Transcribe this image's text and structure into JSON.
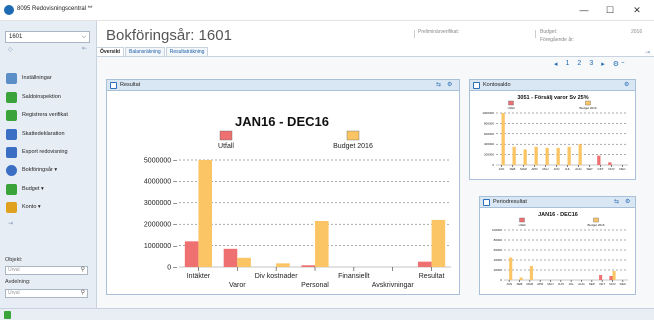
{
  "window": {
    "title": "8095 Redovisningscentral **",
    "minimize": "—",
    "maximize": "☐",
    "close": "✕"
  },
  "sidebar": {
    "year": "1601",
    "items": [
      {
        "label": "Inställningar",
        "icon": "gear-icon",
        "color": "#5c8fc7"
      },
      {
        "label": "Saldoinspektion",
        "icon": "trend-icon",
        "color": "#3aa33a"
      },
      {
        "label": "Registrera verifikat",
        "icon": "trend-icon",
        "color": "#3aa33a"
      },
      {
        "label": "Skattedeklaration",
        "icon": "percent-icon",
        "color": "#3b6fc4"
      },
      {
        "label": "Export redovisning",
        "icon": "printer-icon",
        "color": "#3b6fc4"
      },
      {
        "label": "Bokföringsår ▾",
        "icon": "refresh-icon",
        "color": "#3b6fc4"
      },
      {
        "label": "Budget ▾",
        "icon": "folder-icon",
        "color": "#3aa33a"
      },
      {
        "label": "Konto ▾",
        "icon": "grid-icon",
        "color": "#e0a020"
      }
    ],
    "objekt_label": "Objekt:",
    "objekt_placeholder": "Urval",
    "avdelning_label": "Avdelning:",
    "avdelning_placeholder": "Urval"
  },
  "header": {
    "title": "Bokföringsår: 1601",
    "preliminara": "Preliminärverifikat:",
    "budget_label": "Budget:",
    "budget_value": "2016",
    "foregaende": "Föregående år:"
  },
  "tabs": [
    "Översikt",
    "Balansräkning",
    "Resultaträkning"
  ],
  "pager": {
    "prev": "◂",
    "pages": [
      "1",
      "2",
      "3"
    ],
    "next": "▸",
    "menu": "⚙ ⁼"
  },
  "panels": {
    "resultat": "Resultat",
    "kontosaldo": "Kontosaldo",
    "periodresultat": "Periodresultat"
  },
  "colors": {
    "utfall": "#ef7070",
    "budget": "#fbc565",
    "accent": "#1e6ab3"
  },
  "chart_data": [
    {
      "type": "bar",
      "title": "JAN16 - DEC16",
      "categories": [
        "Intäkter",
        "Varor",
        "Div kostnader",
        "Personal",
        "Finansiellt",
        "Avskrivningar",
        "Resultat"
      ],
      "series": [
        {
          "name": "Utfall",
          "values": [
            1200000,
            850000,
            0,
            80000,
            0,
            0,
            250000
          ]
        },
        {
          "name": "Budget 2016",
          "values": [
            5000000,
            430000,
            170000,
            2150000,
            0,
            0,
            2200000
          ]
        }
      ],
      "ylim": [
        0,
        5000000
      ],
      "yticks": [
        "5000000 –",
        "4000000 –",
        "3000000 –",
        "2000000 –",
        "1000000 –",
        "0 –"
      ],
      "grid": true,
      "legend": "top"
    },
    {
      "type": "bar",
      "title": "3051 - Försälj varor Sv 25%",
      "categories": [
        "JAN",
        "FEB",
        "MAR",
        "APR",
        "MAJ",
        "JUN",
        "JUL",
        "AUG",
        "SEP",
        "OKT",
        "NOV",
        "DEC"
      ],
      "series": [
        {
          "name": "Utfall",
          "values": [
            0,
            0,
            0,
            0,
            0,
            0,
            0,
            0,
            0,
            18000,
            5000,
            0
          ]
        },
        {
          "name": "Budget 2016",
          "values": [
            100000,
            35000,
            30000,
            35000,
            33000,
            33000,
            35000,
            40000,
            0,
            0,
            0,
            0
          ]
        }
      ],
      "ylim": [
        0,
        100000
      ],
      "yticks": [
        "1000000",
        "800000",
        "600000",
        "400000",
        "200000",
        "0"
      ],
      "grid": true,
      "legend": "top"
    },
    {
      "type": "bar",
      "title": "JAN16 - DEC16",
      "categories": [
        "JAN",
        "FEB",
        "MAR",
        "APR",
        "MAJ",
        "JUN",
        "JUL",
        "AUG",
        "SEP",
        "OKT",
        "NOV",
        "DEC"
      ],
      "series": [
        {
          "name": "Utfall",
          "values": [
            0,
            0,
            0,
            0,
            0,
            0,
            0,
            0,
            0,
            10000,
            8000,
            0
          ]
        },
        {
          "name": "Budget 2016",
          "values": [
            45000,
            5000,
            28000,
            0,
            0,
            0,
            0,
            0,
            0,
            0,
            18000,
            0
          ]
        }
      ],
      "ylim": [
        0,
        100000
      ],
      "yticks": [
        "100000",
        "80000",
        "60000",
        "40000",
        "20000",
        "0"
      ],
      "grid": true,
      "legend": "top"
    }
  ]
}
